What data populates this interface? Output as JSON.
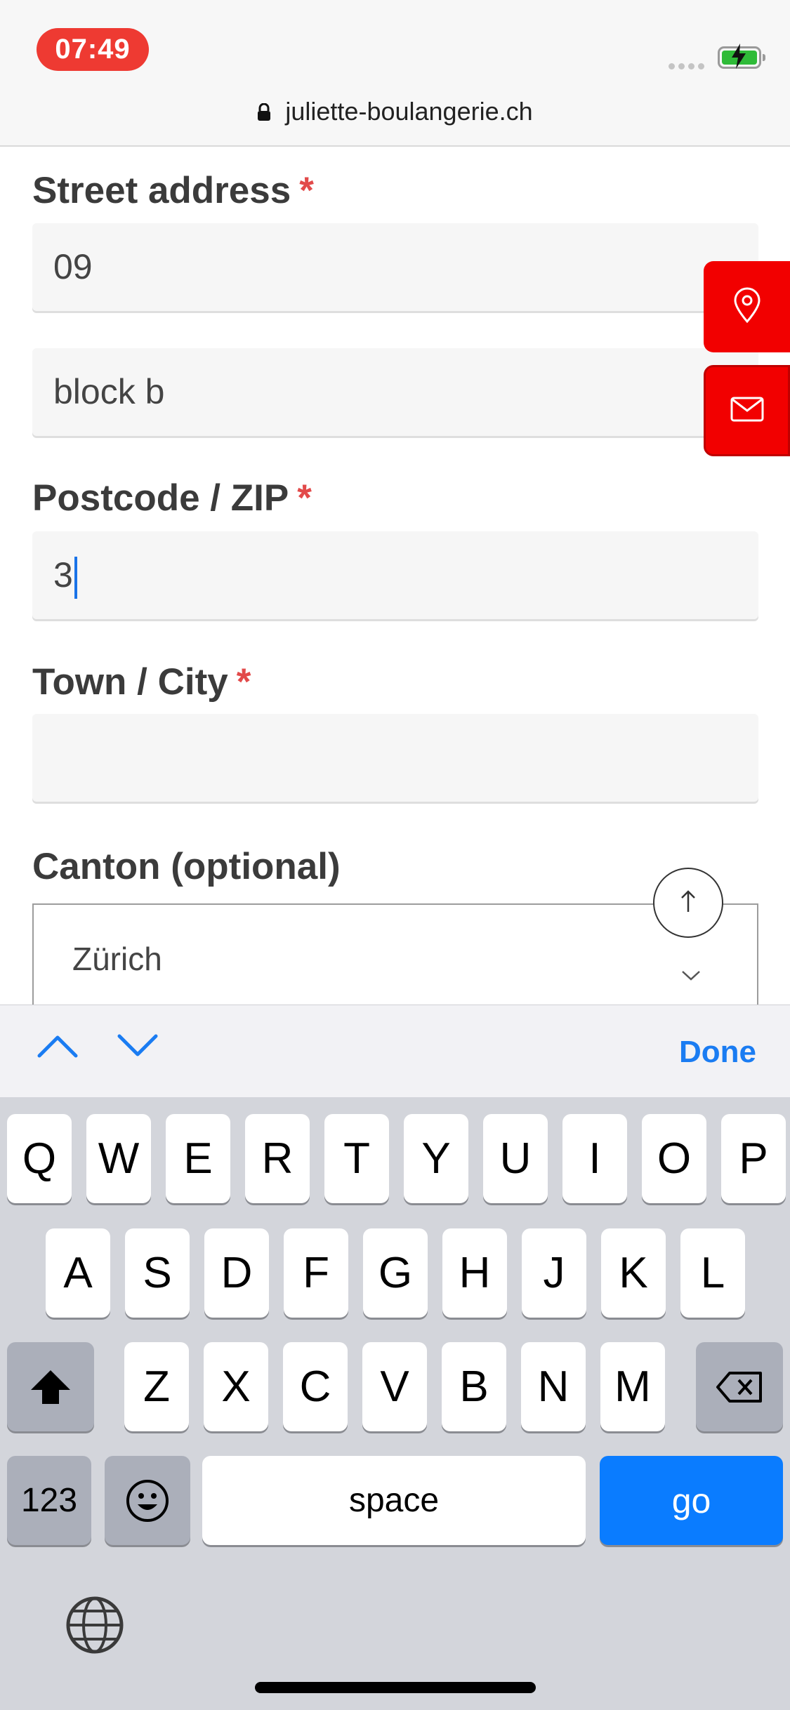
{
  "status_bar": {
    "time": "07:49"
  },
  "url_bar": {
    "domain": "juliette-boulangerie.ch"
  },
  "form": {
    "street_label": "Street address",
    "required_mark": "*",
    "street_line1_value": "09",
    "street_line2_value": "block b",
    "postcode_label": "Postcode / ZIP",
    "postcode_value": "3",
    "city_label": "Town / City",
    "city_value": "",
    "canton_label": "Canton",
    "optional_text": "(optional)",
    "canton_value": "Zürich"
  },
  "accessory_bar": {
    "done_label": "Done"
  },
  "keyboard": {
    "row1": [
      "Q",
      "W",
      "E",
      "R",
      "T",
      "Y",
      "U",
      "I",
      "O",
      "P"
    ],
    "row2": [
      "A",
      "S",
      "D",
      "F",
      "G",
      "H",
      "J",
      "K",
      "L"
    ],
    "row3": [
      "Z",
      "X",
      "C",
      "V",
      "B",
      "N",
      "M"
    ],
    "numbers_label": "123",
    "space_label": "space",
    "go_label": "go"
  },
  "colors": {
    "accent_red": "#f20000",
    "required_red": "#e24a4a",
    "ios_blue": "#0a7cff"
  }
}
